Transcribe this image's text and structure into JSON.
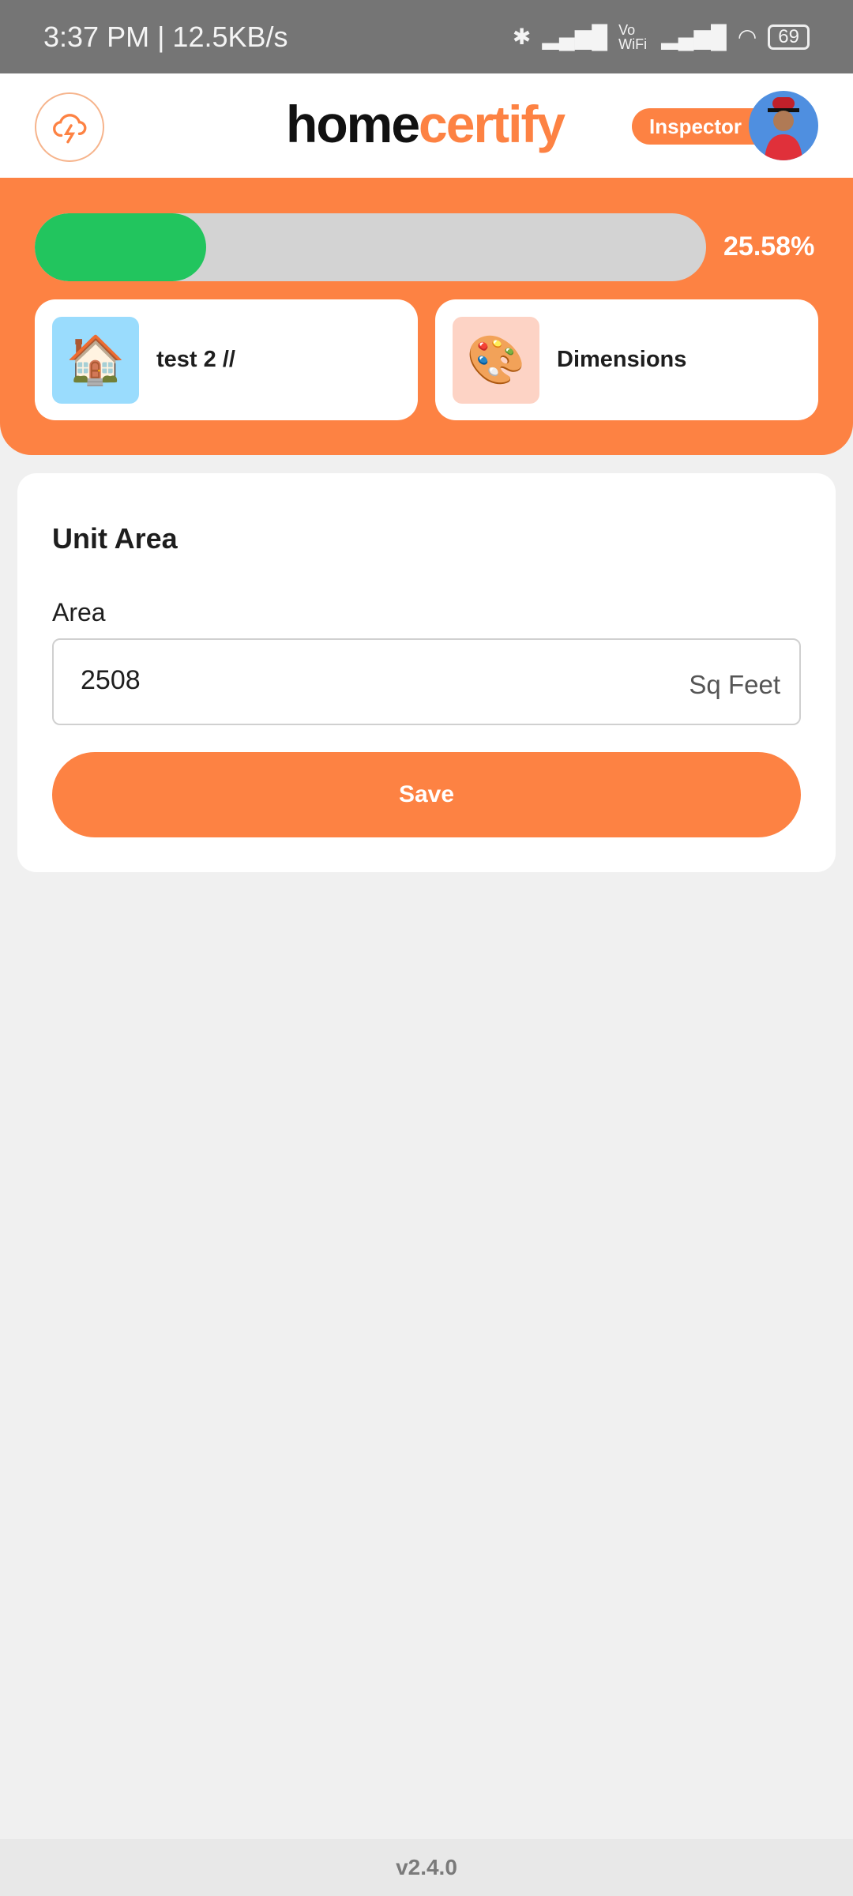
{
  "status_bar": {
    "time": "3:37 PM | 12.5KB/s",
    "network": "Vo WiFi",
    "battery": "69"
  },
  "header": {
    "logo_left": "ho",
    "logo_mid": "me",
    "logo_right": "certify",
    "logo_text": "homecertify",
    "role_badge": "Inspector"
  },
  "progress": {
    "percent_label": "25.58%",
    "value": 25.58,
    "fill_color": "#22c55e"
  },
  "cards": [
    {
      "label": "test 2 //",
      "icon": "house-icon"
    },
    {
      "label": "Dimensions",
      "icon": "abstract-shapes-icon"
    }
  ],
  "form": {
    "title": "Unit Area",
    "field_label": "Area",
    "field_value": "2508",
    "unit": "Sq Feet",
    "save_label": "Save"
  },
  "footer": {
    "version": "v2.4.0"
  },
  "colors": {
    "accent": "#fd8243",
    "progress": "#22c55e"
  }
}
